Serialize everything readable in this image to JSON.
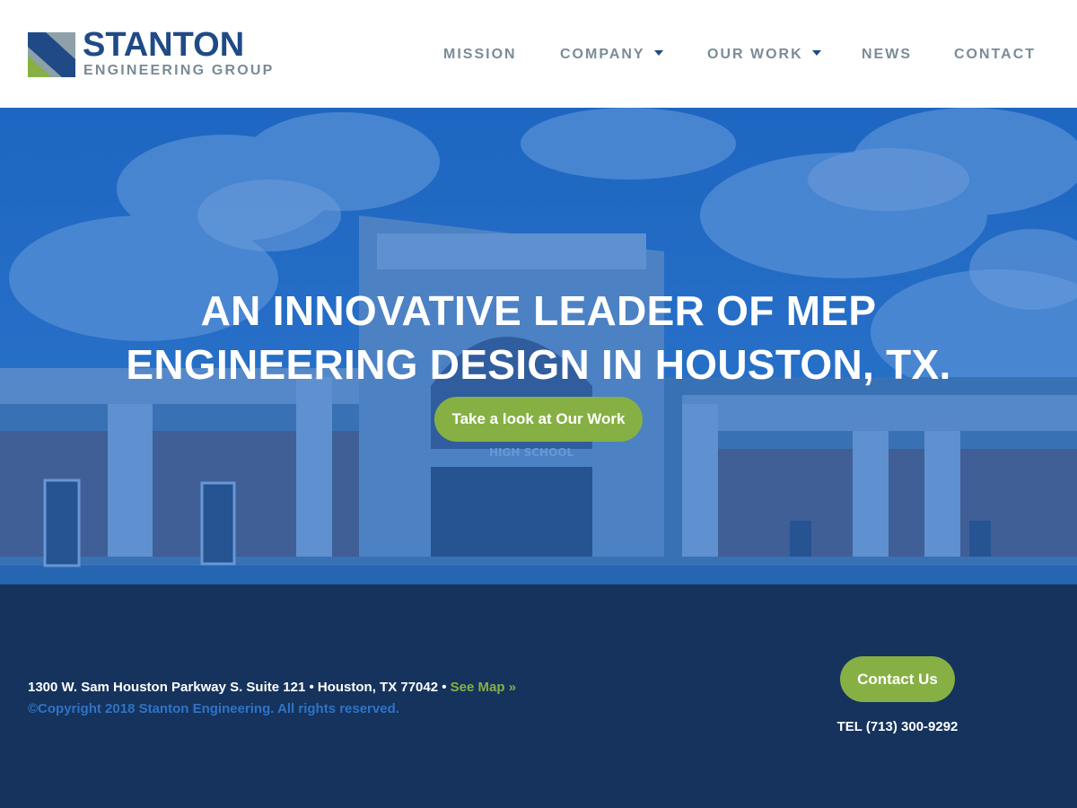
{
  "brand": {
    "name": "STANTON",
    "subtitle": "ENGINEERING GROUP",
    "colors": {
      "blue": "#1f4a86",
      "green": "#86b043",
      "gray": "#7a8c96"
    }
  },
  "nav": {
    "items": [
      {
        "label": "MISSION",
        "has_dropdown": false
      },
      {
        "label": "COMPANY",
        "has_dropdown": true
      },
      {
        "label": "OUR WORK",
        "has_dropdown": true
      },
      {
        "label": "NEWS",
        "has_dropdown": false
      },
      {
        "label": "CONTACT",
        "has_dropdown": false
      }
    ]
  },
  "hero": {
    "title_line1": "AN INNOVATIVE LEADER OF MEP",
    "title_line2": "ENGINEERING DESIGN IN HOUSTON, TX.",
    "cta_label": "Take a look at Our Work",
    "building_sign": "HIGH SCHOOL"
  },
  "footer": {
    "address": "1300 W. Sam Houston Parkway S. Suite 121 • Houston, TX 77042 • ",
    "map_link": "See Map »",
    "copyright": "©Copyright 2018 Stanton Engineering. All rights reserved.",
    "contact_button": "Contact Us",
    "tel": "TEL (713) 300-9292"
  }
}
